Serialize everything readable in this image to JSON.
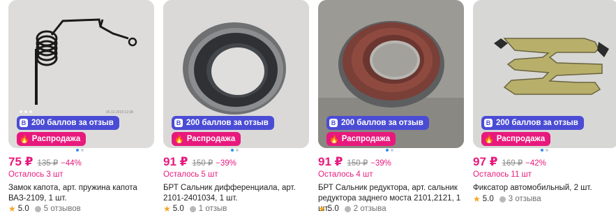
{
  "products": [
    {
      "badge_points": "200 баллов за отзыв",
      "badge_sale": "Распродажа",
      "price": "75 ₽",
      "old_price": "135 ₽",
      "discount": "−44%",
      "stock": "Осталось 3 шт",
      "title": "Замок капота, арт. пружина капота ВАЗ-2109, 1 шт.",
      "rating": "5.0",
      "reviews": "5 отзывов",
      "image_text": "05.12.2019 12:38"
    },
    {
      "badge_points": "200 баллов за отзыв",
      "badge_sale": "Распродажа",
      "price": "91 ₽",
      "old_price": "150 ₽",
      "discount": "−39%",
      "stock": "Осталось 5 шт",
      "title": "БРТ Сальник дифференциала, арт. 2101-2401034, 1 шт.",
      "rating": "5.0",
      "reviews": "1 отзыв"
    },
    {
      "badge_points": "200 баллов за отзыв",
      "badge_sale": "Распродажа",
      "price": "91 ₽",
      "old_price": "150 ₽",
      "discount": "−39%",
      "stock": "Осталось 4 шт",
      "title": "БРТ Сальник редуктора, арт. сальник редуктора заднего моста 2101,2121, 1 шт.",
      "rating": "5.0",
      "reviews": "2 отзыва"
    },
    {
      "badge_points": "200 баллов за отзыв",
      "badge_sale": "Распродажа",
      "price": "97 ₽",
      "old_price": "169 ₽",
      "discount": "−42%",
      "stock": "Осталось 11 шт",
      "title": "Фиксатор автомобильный, 2 шт.",
      "rating": "5.0",
      "reviews": "3 отзыва"
    }
  ],
  "colors": {
    "accent": "#e8197d",
    "points_badge": "#4b4cd5",
    "star": "#f5a623",
    "dot_active": "#2f8cf0"
  },
  "icons": {
    "points_badge": "points-icon",
    "sale_badge": "fire-icon",
    "rating": "star-icon",
    "reviews": "chat-bubble-icon"
  }
}
